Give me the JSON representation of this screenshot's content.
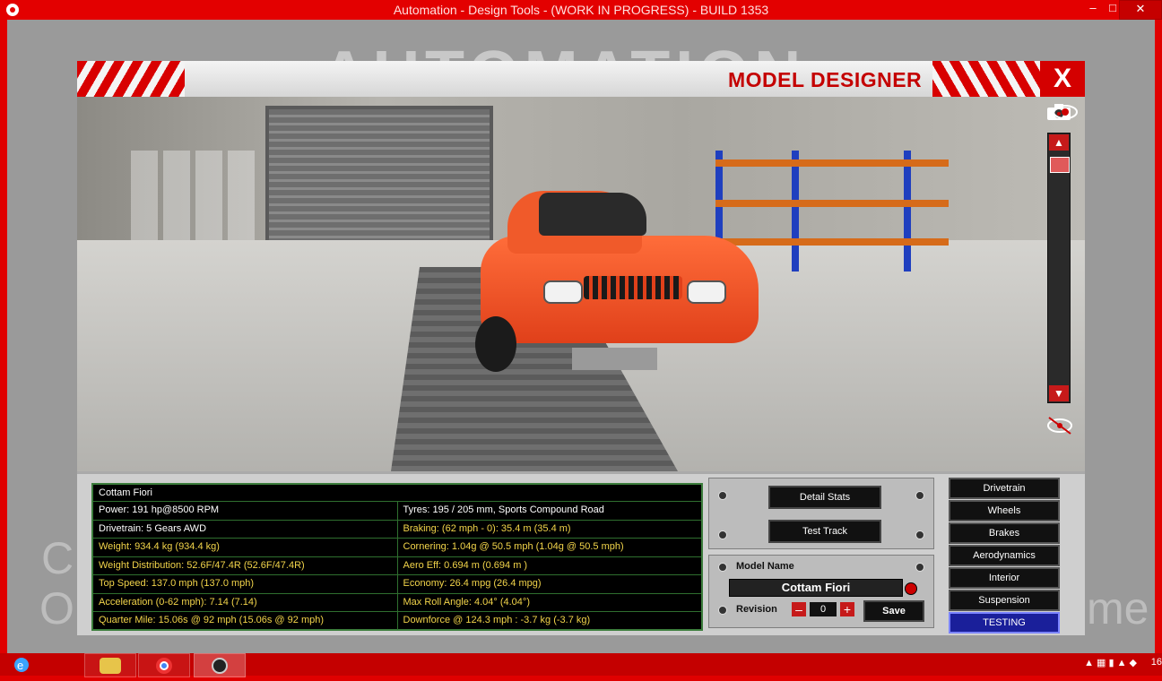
{
  "window": {
    "title": "Automation - Design Tools - (WORK IN PROGRESS) - BUILD 1353",
    "minimize": "–",
    "maximize": "□",
    "close": "✕"
  },
  "background": {
    "logo_text": "AUTOMATION",
    "left_word_1": "C",
    "left_word_2": "O",
    "right_word": "me"
  },
  "model_designer": {
    "title": "MODEL DESIGNER",
    "close_label": "X",
    "camera_icon": "camera-icon",
    "eye_icon": "eye-icon",
    "hide_icon": "eye-crossed-icon"
  },
  "stats": {
    "header": "Cottam Fiori",
    "rows": [
      {
        "left": {
          "text": "Power: 191 hp@8500 RPM",
          "color": "white"
        },
        "right": {
          "text": "Tyres: 195 / 205 mm, Sports Compound Road",
          "color": "white"
        }
      },
      {
        "left": {
          "text": "Drivetrain: 5 Gears AWD",
          "color": "white"
        },
        "right": {
          "text": "Braking: (62 mph - 0): 35.4 m (35.4 m)",
          "color": "yellow"
        }
      },
      {
        "left": {
          "text": "Weight: 934.4 kg (934.4 kg)",
          "color": "yellow"
        },
        "right": {
          "text": "Cornering: 1.04g @ 50.5 mph (1.04g @ 50.5 mph)",
          "color": "yellow"
        }
      },
      {
        "left": {
          "text": "Weight Distribution: 52.6F/47.4R (52.6F/47.4R)",
          "color": "yellow"
        },
        "right": {
          "text": "Aero Eff: 0.694 m  (0.694 m )",
          "color": "yellow"
        }
      },
      {
        "left": {
          "text": "Top Speed: 137.0 mph (137.0 mph)",
          "color": "yellow"
        },
        "right": {
          "text": "Economy: 26.4 mpg (26.4 mpg)",
          "color": "yellow"
        }
      },
      {
        "left": {
          "text": "Acceleration (0-62 mph): 7.14 (7.14)",
          "color": "yellow"
        },
        "right": {
          "text": "Max Roll Angle: 4.04° (4.04°)",
          "color": "yellow"
        }
      },
      {
        "left": {
          "text": "Quarter Mile: 15.06s @ 92 mph (15.06s @ 92 mph)",
          "color": "yellow"
        },
        "right": {
          "text": "Downforce @ 124.3 mph : -3.7 kg (-3.7 kg)",
          "color": "yellow"
        }
      }
    ]
  },
  "actions": {
    "detail_stats": "Detail Stats",
    "test_track": "Test Track"
  },
  "model": {
    "name_label": "Model Name",
    "name_value": "Cottam Fiori",
    "revision_label": "Revision",
    "revision_value": "0",
    "minus": "–",
    "plus": "+",
    "save": "Save"
  },
  "tabs": [
    {
      "label": "Drivetrain",
      "active": false
    },
    {
      "label": "Wheels",
      "active": false
    },
    {
      "label": "Brakes",
      "active": false
    },
    {
      "label": "Aerodynamics",
      "active": false
    },
    {
      "label": "Interior",
      "active": false
    },
    {
      "label": "Suspension",
      "active": false
    },
    {
      "label": "TESTING",
      "active": true
    }
  ],
  "taskbar": {
    "apps": [
      {
        "name": "internet-explorer-icon"
      },
      {
        "name": "file-explorer-icon"
      },
      {
        "name": "chrome-icon"
      },
      {
        "name": "automation-app-icon"
      }
    ],
    "clock": "16"
  },
  "colors": {
    "accent": "#d40000",
    "stat_yellow": "#f2d44a",
    "active_tab": "#1a1f9a"
  }
}
